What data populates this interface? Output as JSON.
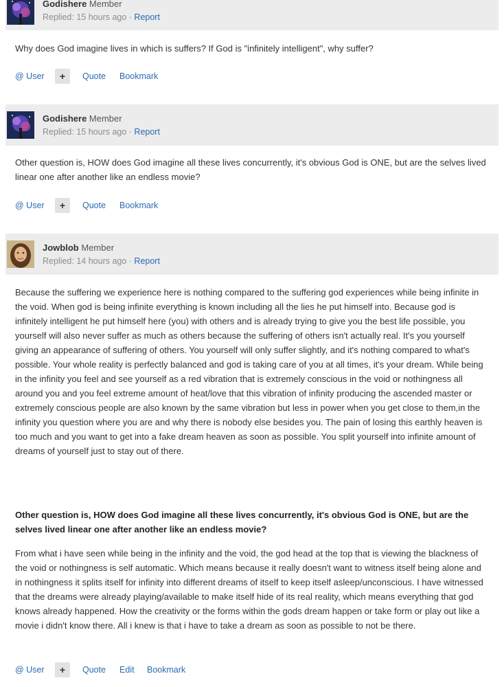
{
  "comments": [
    {
      "author": "Godishere",
      "role": "Member",
      "replied": "Replied: 15 hours ago",
      "sep": " · ",
      "report": "Report",
      "body": "Why does God imagine lives in which is suffers? If God is \"infinitely intelligent\", why suffer?",
      "actions": {
        "user": "@ User",
        "plus": "+",
        "quote": "Quote",
        "bookmark": "Bookmark"
      }
    },
    {
      "author": "Godishere",
      "role": "Member",
      "replied": "Replied: 15 hours ago",
      "sep": " · ",
      "report": "Report",
      "body": "Other question is, HOW does God imagine all these lives concurrently, it's obvious God is ONE, but are the selves lived linear one after another like an endless movie?",
      "actions": {
        "user": "@ User",
        "plus": "+",
        "quote": "Quote",
        "bookmark": "Bookmark"
      }
    },
    {
      "author": "Jowblob",
      "role": "Member",
      "replied": "Replied: 14 hours ago",
      "sep": " · ",
      "report": "Report",
      "body": "Because the suffering we experience here is nothing compared to the suffering god experiences while being infinite in the void. When god is being infinite everything is known including all the lies he put himself into. Because god is infinitely intelligent he put himself here (you) with others and is already trying to give you the best life possible, you yourself will also never suffer as much as others because the suffering of others isn't actually real. It's you yourself giving an appearance of suffering of others. You yourself will only suffer slightly, and it's nothing compared to what's possible. Your whole reality is perfectly balanced and god is taking care of you at all times, it's your dream.  While being in the infinity you feel and see yourself as a red vibration that is extremely conscious in the void or nothingness all around you and you feel extreme amount of heat/love that this vibration of infinity producing the ascended master or extremely conscious people are also known by the same vibration but less in power when you get close to them,in the infinity you question where you are and why there is nobody else besides you. The pain of losing this earthly heaven is too much and you want to get into a fake dream heaven as soon as possible. You split yourself into infinite amount of dreams of yourself just to stay out of there.",
      "quoted_question": "Other question is, HOW does God imagine all these lives concurrently, it's obvious God is ONE, but are the selves lived linear one after another like an endless movie?",
      "body2": "From what i have seen while being in the infinity and the void, the god head at the top that is viewing the blackness of the void or nothingness is self automatic. Which means because it really doesn't want to witness itself being alone and in nothingness it splits itself for infinity into different dreams of itself to keep itself asleep/unconscious. I have witnessed that the dreams were already playing/available to make itself hide of its real reality, which means everything that god knows already happened. How the creativity or the forms within the gods dream happen or take form or play out like a movie i didn't know there. All i knew is that i have to take a dream as soon as possible to not be there.",
      "actions": {
        "user": "@ User",
        "plus": "+",
        "quote": "Quote",
        "edit": "Edit",
        "bookmark": "Bookmark"
      }
    }
  ],
  "icons": {
    "avatar_1": "galaxy-avatar-icon",
    "avatar_3": "portrait-avatar-icon"
  },
  "colors": {
    "link": "#2a6bb0",
    "meta_bar": "#ececec",
    "muted": "#8c8c8c"
  }
}
